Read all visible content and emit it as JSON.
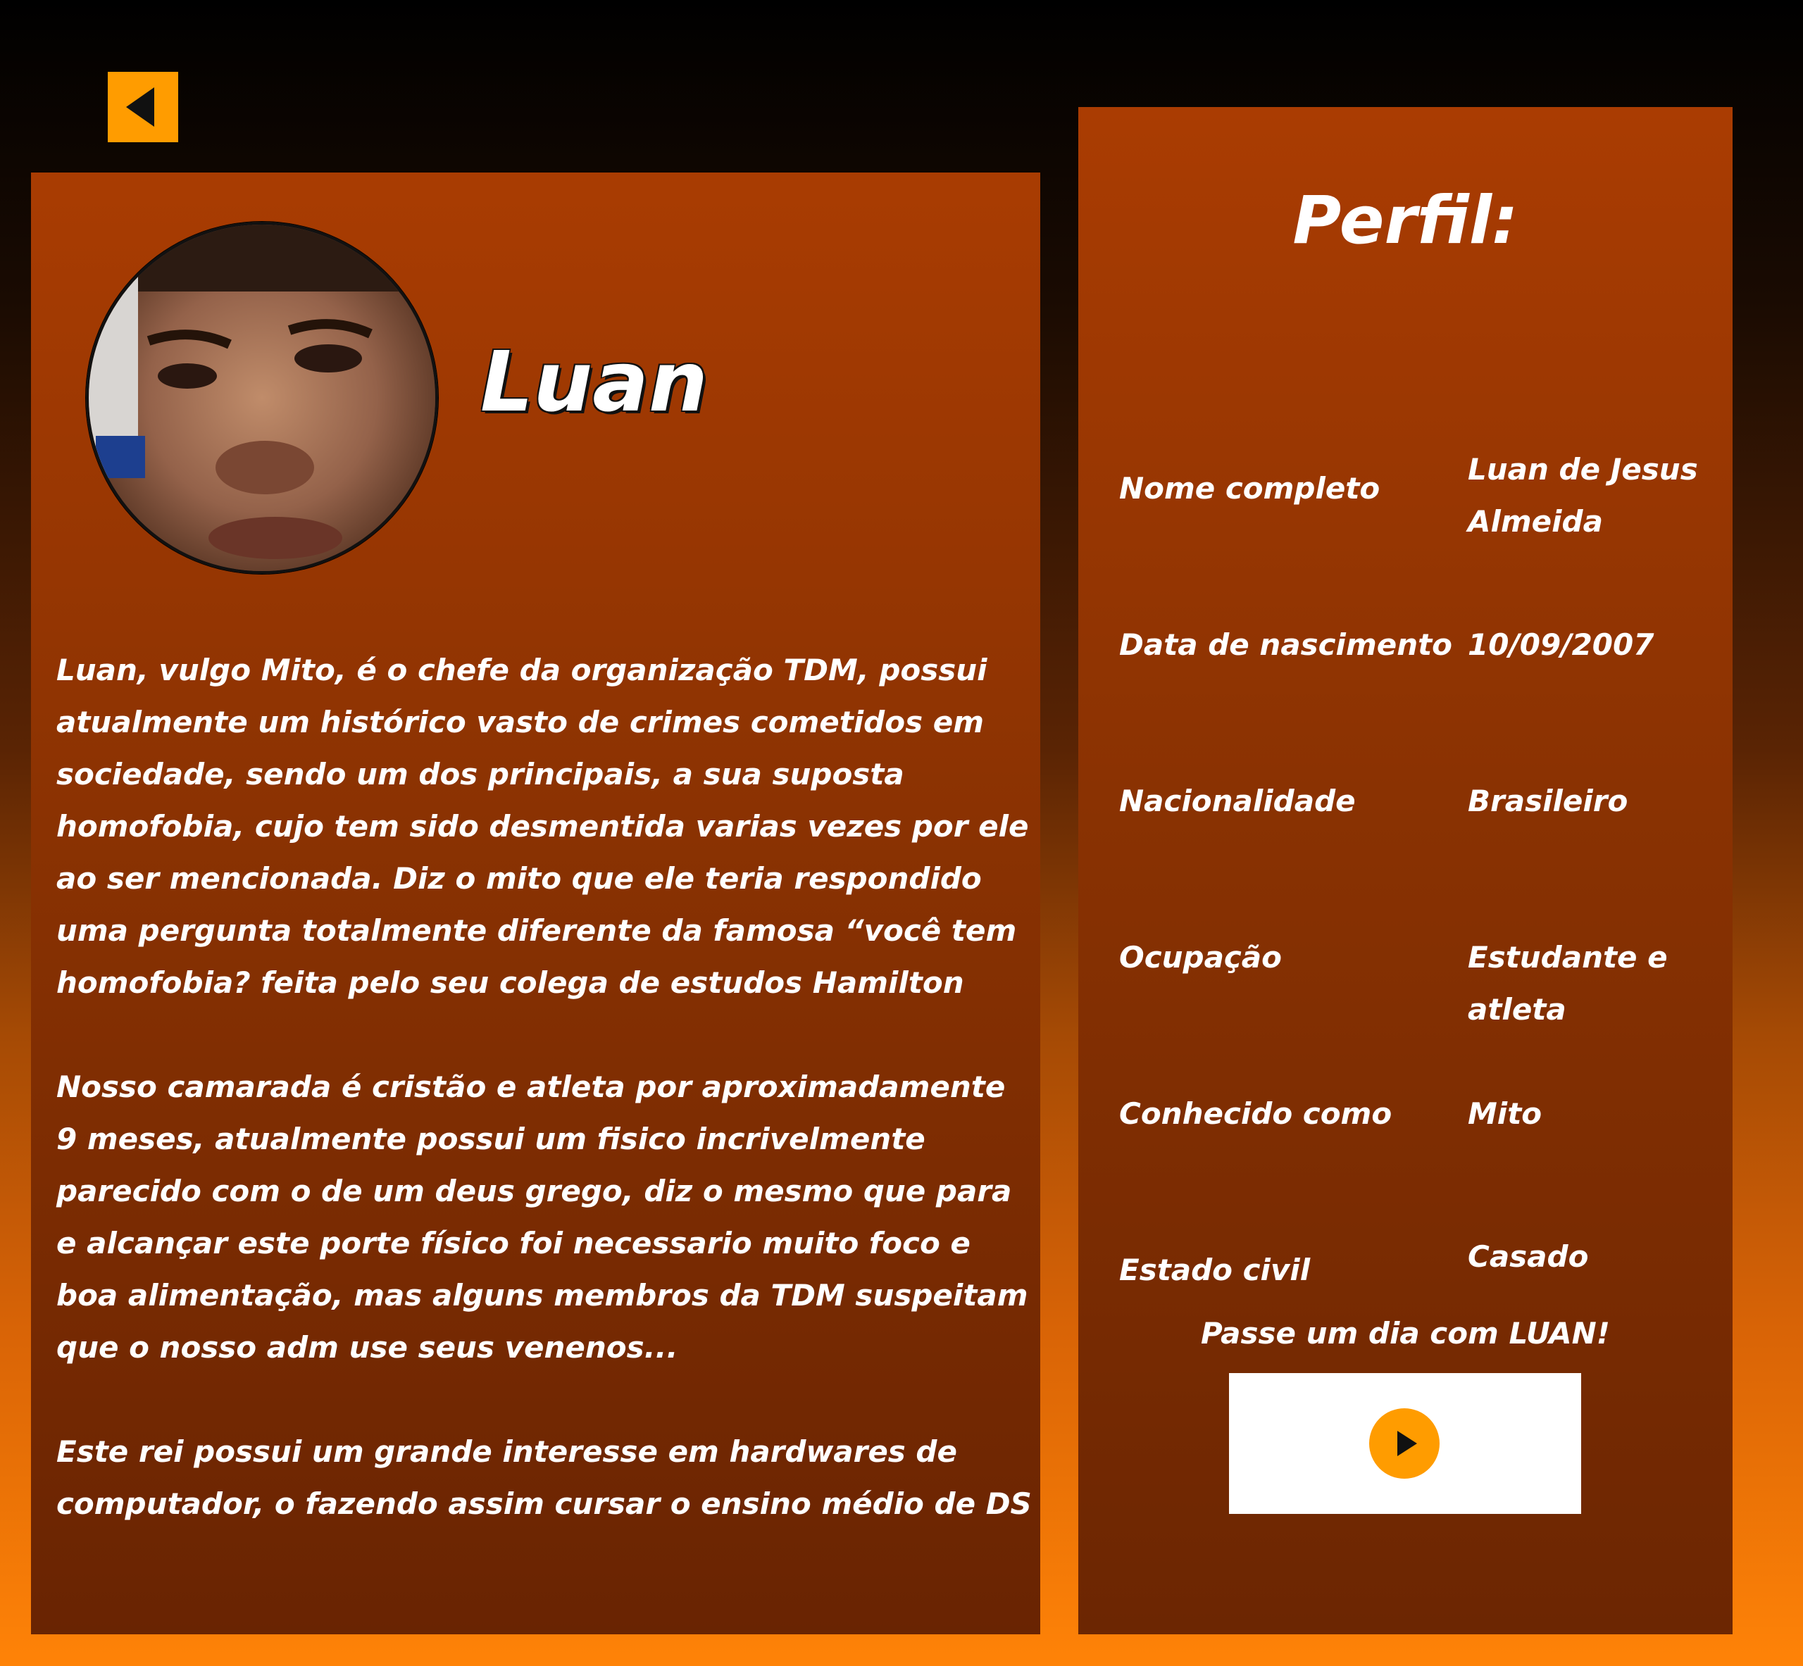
{
  "navigation": {
    "back_icon": "triangle-left-icon",
    "accent_color": "#ff9c00"
  },
  "bio": {
    "name": "Luan",
    "avatar_icon": "person-face-photo",
    "paragraphs": [
      "Luan, vulgo Mito, é o chefe da organização TDM, possui atualmente um histórico vasto de crimes cometidos em sociedade, sendo um dos principais, a sua suposta homofobia, cujo tem sido desmentida varias vezes por ele ao ser mencionada. Diz o mito que ele teria respondido uma pergunta totalmente diferente da famosa “você tem homofobia? feita pelo seu colega de estudos Hamilton",
      "Nosso camarada é cristão e atleta por aproximadamente 9 meses, atualmente possui um fisico incrivelmente parecido com o de um deus grego, diz o mesmo que para e alcançar este porte físico foi necessario muito foco e boa alimentação, mas alguns membros da TDM suspeitam que o nosso adm use seus venenos...",
      "Este rei possui um grande interesse em hardwares de computador, o fazendo assim cursar o ensino médio de DS"
    ]
  },
  "profile": {
    "title": "Perfil:",
    "fields": [
      {
        "label": "Nome completo",
        "value": "Luan de Jesus Almeida"
      },
      {
        "label": "Data de nascimento",
        "value": "10/09/2007"
      },
      {
        "label": "Nacionalidade",
        "value": "Brasileiro"
      },
      {
        "label": "Ocupação",
        "value": "Estudante e atleta"
      },
      {
        "label": "Conhecido como",
        "value": "Mito"
      },
      {
        "label": "Estado civil",
        "value": "Casado"
      }
    ],
    "cta": "Passe um dia com LUAN!",
    "play_icon": "play-icon"
  }
}
